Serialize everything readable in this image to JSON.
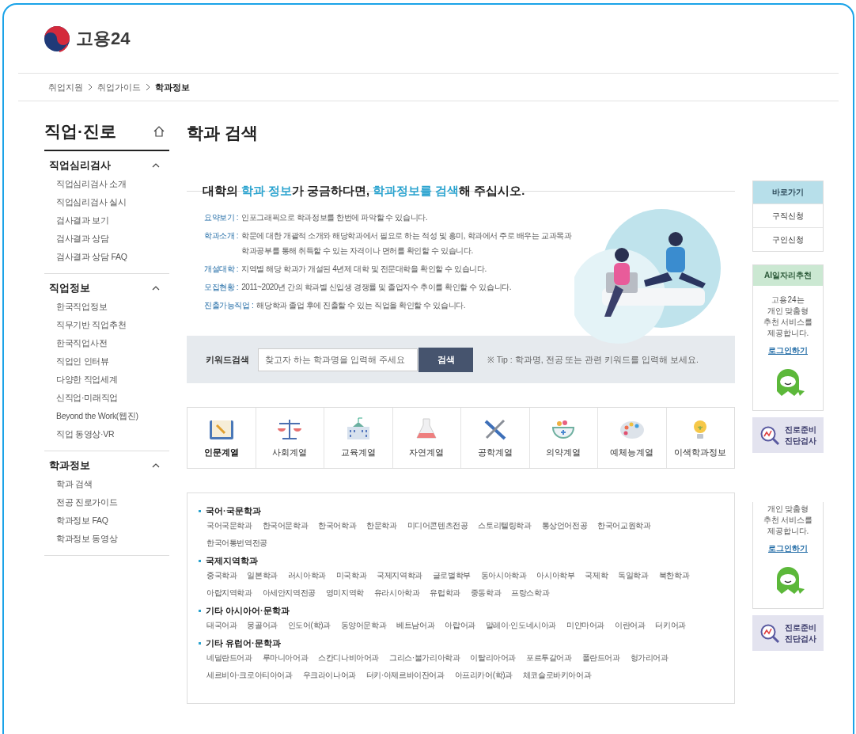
{
  "logo": {
    "text": "고용24"
  },
  "breadcrumb": [
    {
      "label": "취업지원",
      "current": false
    },
    {
      "label": "취업가이드",
      "current": false
    },
    {
      "label": "학과정보",
      "current": true
    }
  ],
  "sidebar": {
    "title": "직업·진로",
    "sections": [
      {
        "title": "직업심리검사",
        "expanded": true,
        "items": [
          "직업심리검사 소개",
          "직업심리검사 실시",
          "검사결과 보기",
          "검사결과 상담",
          "검사결과 상담 FAQ"
        ]
      },
      {
        "title": "직업정보",
        "expanded": true,
        "items": [
          "한국직업정보",
          "직무기반 직업추천",
          "한국직업사전",
          "직업인 인터뷰",
          "다양한 직업세계",
          "신직업·미래직업",
          "Beyond the Work(웹진)",
          "직업 동영상·VR"
        ]
      },
      {
        "title": "학과정보",
        "expanded": true,
        "items": [
          "학과 검색",
          "전공 진로가이드",
          "학과정보 FAQ",
          "학과정보 동영상"
        ]
      }
    ]
  },
  "page_title": "학과 검색",
  "headline": [
    {
      "text": "대학의 ",
      "highlight": false
    },
    {
      "text": "학과 정보",
      "highlight": true
    },
    {
      "text": "가 궁금하다면, ",
      "highlight": false
    },
    {
      "text": "학과정보를 검색",
      "highlight": true
    },
    {
      "text": "해 주십시오.",
      "highlight": false
    }
  ],
  "descriptions": [
    {
      "term": "요약보기 :",
      "text": "인포그래픽으로 학과정보를 한번에 파악할 수 있습니다."
    },
    {
      "term": "학과소개 :",
      "text": "학문에 대한 개괄적 소개와 해당학과에서 필요로 하는 적성 및 흥미, 학과에서 주로 배우는 교과목과 학과공부를 통해 취득할 수 있는 자격이나 면허를 확인할 수 있습니다."
    },
    {
      "term": "개설대학 :",
      "text": "지역별 해당 학과가 개설된 4년제 대학 및 전문대학을 확인할 수 있습니다."
    },
    {
      "term": "모집현황 :",
      "text": "2011~2020년 간의 학과별 신입생 경쟁률 및 졸업자수 추이를 확인할 수 있습니다."
    },
    {
      "term": "진출가능직업 :",
      "text": "해당학과 졸업 후에 진출할 수 있는 직업을 확인할 수 있습니다."
    }
  ],
  "search": {
    "label": "키워드검색",
    "placeholder": "찾고자 하는 학과명을 입력해 주세요",
    "button": "검색",
    "tip": "※ Tip : 학과명, 전공 또는 관련 키워드를 입력해 보세요."
  },
  "categories": [
    {
      "label": "인문계열",
      "kind": "book",
      "selected": true
    },
    {
      "label": "사회계열",
      "kind": "scale",
      "selected": false
    },
    {
      "label": "교육계열",
      "kind": "school",
      "selected": false
    },
    {
      "label": "자연계열",
      "kind": "flask",
      "selected": false
    },
    {
      "label": "공학계열",
      "kind": "tools",
      "selected": false
    },
    {
      "label": "의약계열",
      "kind": "mortar",
      "selected": false
    },
    {
      "label": "예체능계열",
      "kind": "palette",
      "selected": false
    },
    {
      "label": "이색학과정보",
      "kind": "bulb",
      "selected": false
    }
  ],
  "departments": [
    {
      "group": "국어·국문학과",
      "items": [
        "국어국문학과",
        "한국어문학과",
        "한국어학과",
        "한문학과",
        "미디어콘텐츠전공",
        "스토리텔링학과",
        "통상언어전공",
        "한국어교원학과",
        "한국어통번역전공"
      ]
    },
    {
      "group": "국제지역학과",
      "items": [
        "중국학과",
        "일본학과",
        "러시아학과",
        "미국학과",
        "국제지역학과",
        "글로벌학부",
        "동아시아학과",
        "아시아학부",
        "국제학",
        "독일학과",
        "북한학과",
        "아랍지역학과",
        "아세안지역전공",
        "영미지역학",
        "유라시아학과",
        "유럽학과",
        "중동학과",
        "프랑스학과"
      ]
    },
    {
      "group": "기타 아시아어·문학과",
      "items": [
        "태국어과",
        "몽골어과",
        "인도어(학)과",
        "동양어문학과",
        "베트남어과",
        "아랍어과",
        "말레이·인도네시아과",
        "미얀마어과",
        "이란어과",
        "터키어과"
      ]
    },
    {
      "group": "기타 유럽어·문학과",
      "items": [
        "네덜란드어과",
        "루마니아어과",
        "스칸디나비아어과",
        "그리스·불가리아학과",
        "이탈리아어과",
        "포르투갈어과",
        "폴란드어과",
        "헝가리어과",
        "세르비아·크로아티아어과",
        "우크라이나어과",
        "터키·아제르바이잔어과",
        "아프리카어(학)과",
        "체코슬로바키아어과"
      ]
    }
  ],
  "quick_menu": {
    "title": "바로가기",
    "items": [
      "구직신청",
      "구인신청"
    ]
  },
  "ai_panel": {
    "title": "AI일자리추천",
    "lines": [
      "고용24는",
      "개인 맞춤형",
      "추천 서비스를",
      "제공합니다."
    ],
    "link": "로그인하기"
  },
  "diagnosis": {
    "lines": [
      "진로준비",
      "진단검사"
    ]
  },
  "ai_panel_repeat": {
    "lines": [
      "개인 맞춤형",
      "추천 서비스를",
      "제공합니다."
    ],
    "link": "로그인하기"
  },
  "diagnosis_repeat": {
    "lines": [
      "진로준비",
      "진단검사"
    ]
  }
}
